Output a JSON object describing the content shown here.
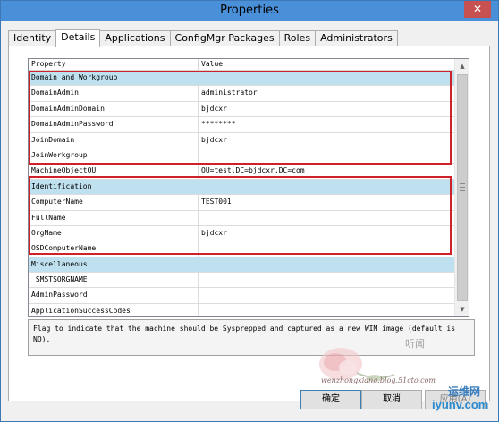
{
  "window": {
    "title": "Properties",
    "close_glyph": "✕"
  },
  "tabs": [
    {
      "label": "Identity",
      "active": false
    },
    {
      "label": "Details",
      "active": true
    },
    {
      "label": "Applications",
      "active": false
    },
    {
      "label": "ConfigMgr Packages",
      "active": false
    },
    {
      "label": "Roles",
      "active": false
    },
    {
      "label": "Administrators",
      "active": false
    }
  ],
  "grid": {
    "columns": [
      "Property",
      "Value"
    ],
    "rows": [
      {
        "property": "Domain and Workgroup",
        "value": "",
        "category": true
      },
      {
        "property": "DomainAdmin",
        "value": "administrator",
        "category": false
      },
      {
        "property": "DomainAdminDomain",
        "value": "bjdcxr",
        "category": false
      },
      {
        "property": "DomainAdminPassword",
        "value": "********",
        "category": false
      },
      {
        "property": "JoinDomain",
        "value": "bjdcxr",
        "category": false
      },
      {
        "property": "JoinWorkgroup",
        "value": "",
        "category": false
      },
      {
        "property": "MachineObjectOU",
        "value": "OU=test,DC=bjdcxr,DC=com",
        "category": false
      },
      {
        "property": "Identification",
        "value": "",
        "category": true
      },
      {
        "property": "ComputerName",
        "value": "TEST001",
        "category": false
      },
      {
        "property": "FullName",
        "value": "",
        "category": false
      },
      {
        "property": "OrgName",
        "value": "bjdcxr",
        "category": false
      },
      {
        "property": "OSDComputerName",
        "value": "",
        "category": false
      },
      {
        "property": "Miscellaneous",
        "value": "",
        "category": true
      },
      {
        "property": "_SMSTSORGNAME",
        "value": "",
        "category": false
      },
      {
        "property": "AdminPassword",
        "value": "",
        "category": false
      },
      {
        "property": "ApplicationSuccessCodes",
        "value": "",
        "category": false
      }
    ],
    "highlight_color": "#d0202a",
    "category_color": "#bee0ef"
  },
  "description": "Flag to indicate that the machine should be Sysprepped and captured as a new WIM image (default is NO).",
  "buttons": {
    "ok": "确定",
    "cancel": "取消",
    "apply": "应用(A)"
  },
  "watermark": {
    "author_cn": "听闻",
    "blog": "wenzhongxiang.blog.51cto.com",
    "site_name": "运维网",
    "site_url": "iyunv.com"
  },
  "icons": {
    "scroll_up": "▲",
    "scroll_down": "▼"
  }
}
